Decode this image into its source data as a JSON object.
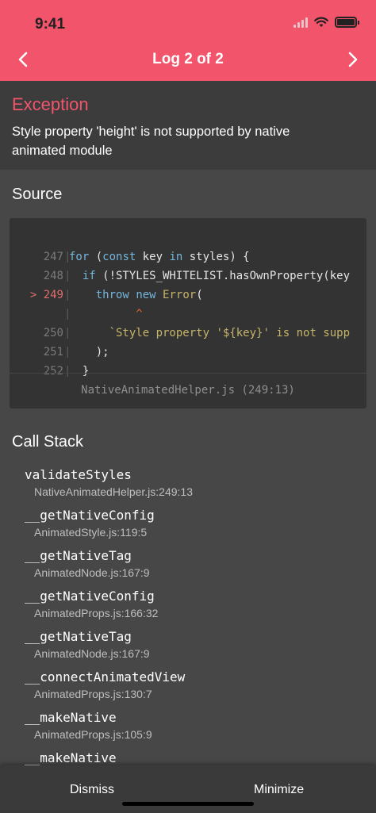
{
  "status_bar": {
    "time": "9:41"
  },
  "nav": {
    "title": "Log 2 of 2",
    "prev_icon": "chevron-left-icon",
    "next_icon": "chevron-right-icon"
  },
  "exception": {
    "title": "Exception",
    "message_line1": "Style property 'height' is not supported by native",
    "message_line2": "animated module"
  },
  "source": {
    "title": "Source",
    "lines": [
      {
        "number": "247",
        "code": "for (const key in styles) {"
      },
      {
        "number": "248",
        "code": "  if (!STYLES_WHITELIST.hasOwnProperty(key"
      },
      {
        "number": "249",
        "code": "    throw new Error("
      },
      {
        "number": "",
        "code": "          ^"
      },
      {
        "number": "250",
        "code": "      `Style property '${key}' is not supp"
      },
      {
        "number": "251",
        "code": "    );"
      },
      {
        "number": "252",
        "code": "  }"
      }
    ],
    "highlight_marker": ">",
    "file": "NativeAnimatedHelper.js (249:13)"
  },
  "call_stack": {
    "title": "Call Stack",
    "frames": [
      {
        "name": "validateStyles",
        "location": "NativeAnimatedHelper.js:249:13"
      },
      {
        "name": "__getNativeConfig",
        "location": "AnimatedStyle.js:119:5"
      },
      {
        "name": "__getNativeTag",
        "location": "AnimatedNode.js:167:9"
      },
      {
        "name": "__getNativeConfig",
        "location": "AnimatedProps.js:166:32"
      },
      {
        "name": "__getNativeTag",
        "location": "AnimatedNode.js:167:9"
      },
      {
        "name": "__connectAnimatedView",
        "location": "AnimatedProps.js:130:7"
      },
      {
        "name": "__makeNative",
        "location": "AnimatedProps.js:105:9"
      },
      {
        "name": "__makeNative",
        "location": ""
      }
    ]
  },
  "bottom_bar": {
    "dismiss_label": "Dismiss",
    "minimize_label": "Minimize"
  },
  "colors": {
    "accent": "#f1546b",
    "background": "#474747",
    "panel": "#3c3c3c",
    "code_bg": "#333333"
  }
}
